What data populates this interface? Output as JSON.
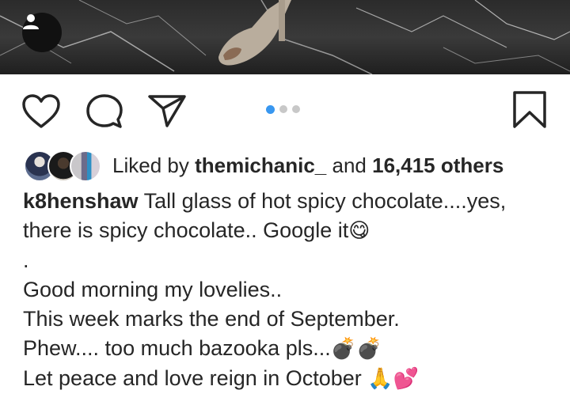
{
  "post": {
    "liked_by_prefix": "Liked by",
    "liked_by_user": "themichanic_",
    "liked_and": "and",
    "likes_count_text": "16,415 others",
    "caption_user": "k8henshaw",
    "caption_lines": [
      "Tall glass of hot spicy chocolate....yes,",
      "there is spicy chocolate.. Google it",
      ".",
      "Good morning my lovelies..",
      "This week marks the end of September.",
      "Phew.... too much bazooka pls...",
      "Let peace and love reign in October"
    ],
    "emojis": {
      "yum": "😋",
      "bombs": "💣💣",
      "pray_hearts": "🙏💕"
    }
  },
  "carousel": {
    "total": 3,
    "active_index": 0
  },
  "icons": {
    "user_tag": "person-icon",
    "like": "heart-icon",
    "comment": "comment-icon",
    "share": "send-icon",
    "save": "bookmark-icon"
  },
  "colors": {
    "accent": "#3897f0",
    "text": "#262626",
    "dot_inactive": "#c8c8c8"
  }
}
